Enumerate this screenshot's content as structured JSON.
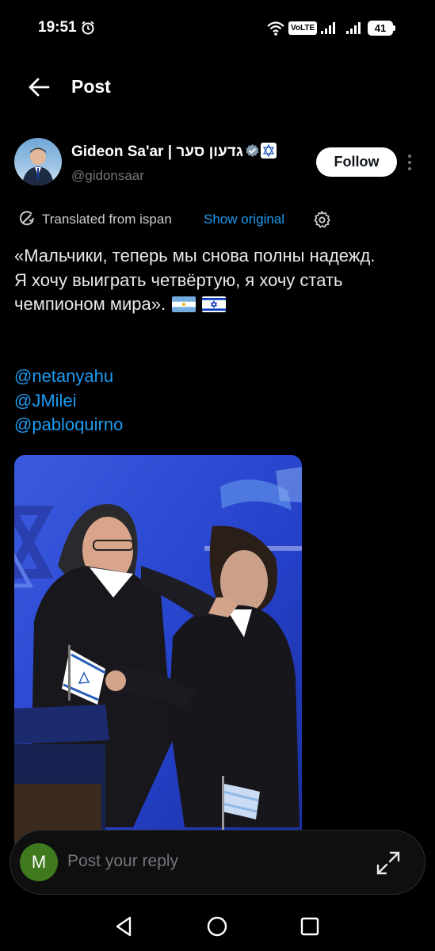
{
  "status_bar": {
    "time": "19:51",
    "volte": "VoLTE",
    "battery": "41",
    "icons": [
      "alarm-icon",
      "wifi-icon",
      "signal-icon",
      "signal-icon",
      "battery-icon"
    ]
  },
  "header": {
    "title": "Post",
    "back_icon": "arrow-left-icon"
  },
  "author": {
    "display_name": "Gideon Sa'ar | גדעון סער",
    "handle": "@gidonsaar",
    "follow_label": "Follow",
    "verified": true
  },
  "translation": {
    "label": "Translated from ispan",
    "show_original": "Show original"
  },
  "tweet": {
    "line1": "«Мальчики, теперь мы снова полны надежд.",
    "line2": "Я хочу выиграть четвёртую, я хочу стать чемпионом мира».",
    "mentions": [
      "@netanyahu",
      "@JMilei",
      "@pabloquirno"
    ]
  },
  "reply": {
    "avatar_letter": "M",
    "placeholder": "Post your reply"
  },
  "colors": {
    "accent": "#1d9bf0",
    "background": "#000000",
    "text": "#e7e9ea",
    "muted": "#71767b"
  }
}
